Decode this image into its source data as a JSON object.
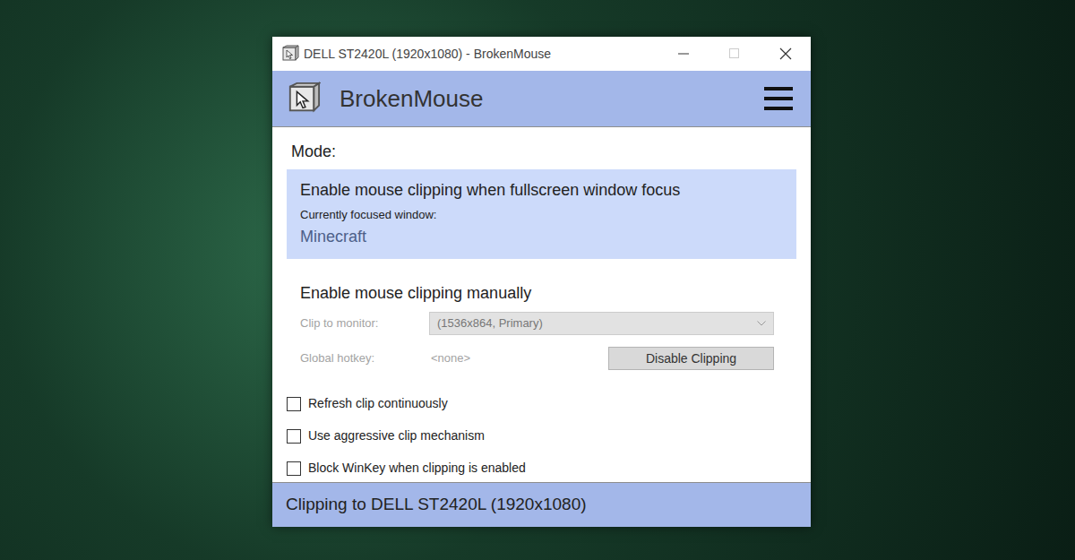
{
  "window": {
    "title": "DELL ST2420L (1920x1080) - BrokenMouse",
    "controls": [
      {
        "kind": "minimize",
        "disabled": false
      },
      {
        "kind": "maximize",
        "disabled": true
      },
      {
        "kind": "close",
        "disabled": false
      }
    ]
  },
  "header": {
    "app_name": "BrokenMouse"
  },
  "mode_heading": "Mode:",
  "modes": [
    {
      "title": "Enable mouse clipping when fullscreen window focus",
      "selected": true,
      "detail_label": "Currently focused window:",
      "detail_value": "Minecraft"
    },
    {
      "title": "Enable mouse clipping manually",
      "selected": false
    }
  ],
  "manual_rows": [
    {
      "kind": "select",
      "label": "Clip to monitor:",
      "value": "(1536x864, Primary)",
      "disabled": true
    },
    {
      "kind": "hotkey",
      "label": "Global hotkey:",
      "value": "<none>",
      "disabled": true,
      "button": {
        "label": "Disable Clipping",
        "disabled": true
      }
    }
  ],
  "options": [
    {
      "label": "Refresh clip continuously",
      "checked": false
    },
    {
      "label": "Use aggressive clip mechanism",
      "checked": false
    },
    {
      "label": "Block WinKey when clipping is enabled",
      "checked": false
    }
  ],
  "status_bar": "Clipping to DELL ST2420L (1920x1080)"
}
